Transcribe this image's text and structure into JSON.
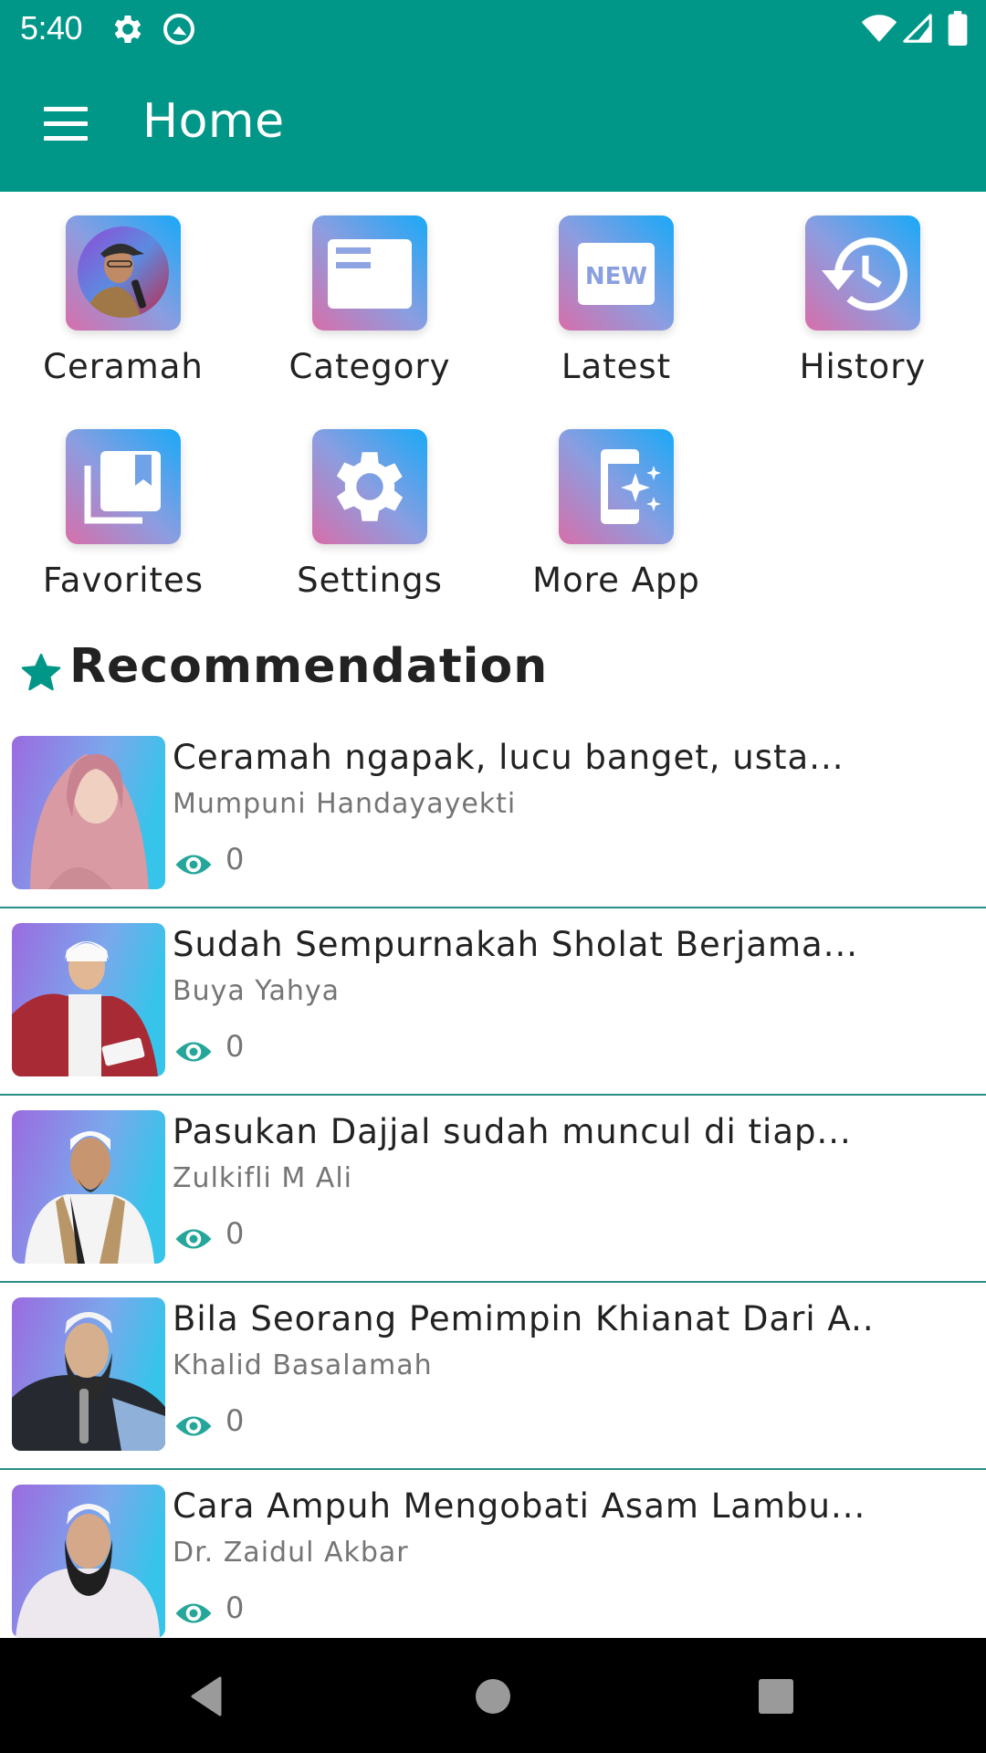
{
  "status_bar": {
    "time": "5:40",
    "icons": [
      "settings-gear-icon",
      "q-logo-icon",
      "wifi-icon",
      "cell-signal-icon",
      "battery-icon"
    ]
  },
  "app_bar": {
    "title": "Home",
    "menu_icon": "hamburger-menu-icon",
    "color": "#009688"
  },
  "menu_grid": {
    "items": [
      {
        "label": "Ceramah",
        "icon": "speaker-avatar-icon"
      },
      {
        "label": "Category",
        "icon": "category-card-icon"
      },
      {
        "label": "Latest",
        "icon": "new-badge-icon"
      },
      {
        "label": "History",
        "icon": "history-clock-icon"
      },
      {
        "label": "Favorites",
        "icon": "bookmark-library-icon"
      },
      {
        "label": "Settings",
        "icon": "settings-gear-icon"
      },
      {
        "label": "More App",
        "icon": "app-sparkle-icon"
      }
    ],
    "tile_gradient": [
      "#d86ea9",
      "#1aa9f7"
    ]
  },
  "recommendation": {
    "title": "Recommendation",
    "icon": "star-icon",
    "accent": "#009688",
    "items": [
      {
        "title": "Ceramah ngapak,  lucu banget,  usta...",
        "author": "Mumpuni Handayayekti",
        "views": "0"
      },
      {
        "title": "Sudah Sempurnakah Sholat Berjama...",
        "author": "Buya Yahya",
        "views": "0"
      },
      {
        "title": "Pasukan Dajjal sudah muncul di tiap...",
        "author": "Zulkifli M Ali",
        "views": "0"
      },
      {
        "title": "Bila Seorang Pemimpin Khianat Dari A...",
        "author": "Khalid Basalamah",
        "views": "0"
      },
      {
        "title": "Cara Ampuh Mengobati Asam Lambu...",
        "author": "Dr. Zaidul Akbar",
        "views": "0"
      }
    ]
  },
  "nav_bar": {
    "buttons": [
      "back-icon",
      "home-icon",
      "recents-icon"
    ]
  }
}
